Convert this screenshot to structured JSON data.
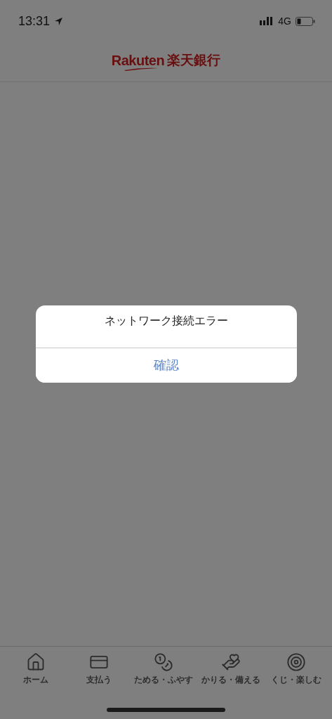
{
  "status_bar": {
    "time": "13:31",
    "network": "4G"
  },
  "header": {
    "logo_latin": "Rakuten",
    "logo_japanese": "楽天銀行"
  },
  "dialog": {
    "message": "ネットワーク接続エラー",
    "button": "確認"
  },
  "tab_bar": [
    {
      "kind": "home",
      "label": "ホーム"
    },
    {
      "kind": "pay",
      "label": "支払う"
    },
    {
      "kind": "save",
      "label": "ためる・ふやす"
    },
    {
      "kind": "borrow",
      "label": "かりる・備える"
    },
    {
      "kind": "lottery",
      "label": "くじ・楽しむ"
    }
  ]
}
